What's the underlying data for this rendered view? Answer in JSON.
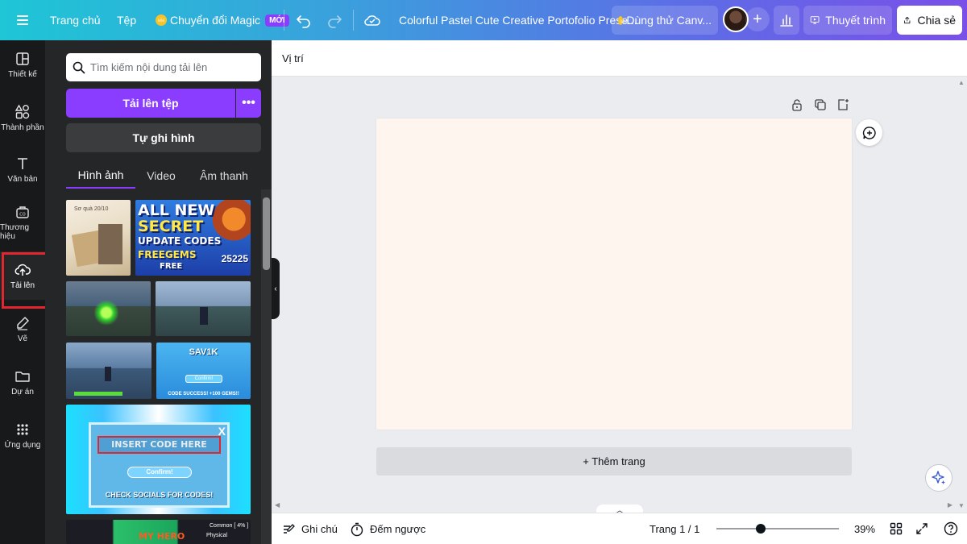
{
  "topbar": {
    "home": "Trang chủ",
    "file": "Tệp",
    "magic": "Chuyển đổi Magic",
    "magic_badge": "MỚI",
    "doc_title": "Colorful Pastel Cute Creative Portofolio Prese...",
    "trial": "Dùng thử Canv...",
    "present": "Thuyết trình",
    "share": "Chia sẻ"
  },
  "rail": {
    "items": [
      {
        "label": "Thiết kế",
        "icon": "layout-icon"
      },
      {
        "label": "Thành phần",
        "icon": "shapes-icon"
      },
      {
        "label": "Văn bản",
        "icon": "text-icon"
      },
      {
        "label": "Thương hiệu",
        "icon": "brand-icon"
      },
      {
        "label": "Tải lên",
        "icon": "cloud-upload-icon"
      },
      {
        "label": "Vẽ",
        "icon": "pen-icon"
      },
      {
        "label": "Dự án",
        "icon": "folder-icon"
      },
      {
        "label": "Ứng dụng",
        "icon": "apps-grid-icon"
      }
    ]
  },
  "panel": {
    "search_placeholder": "Tìm kiếm nội dung tải lên",
    "upload_button": "Tải lên tệp",
    "record_button": "Tự ghi hình",
    "tabs": [
      "Hình ảnh",
      "Video",
      "Âm thanh"
    ],
    "thumbnails": {
      "t1_caption": "Sơ quà 20/10",
      "t2_lines": [
        "ALL NEW",
        "SECRET",
        "UPDATE CODES",
        "FREEGEMS",
        "FREE"
      ],
      "t2_number": "25225",
      "t6_title": "SAV1K",
      "t6_button": "Confirm!",
      "t6_footer": "CODE SUCCESS! +100 GEMS!!",
      "t7_code": "INSERT CODE HERE",
      "t7_confirm": "Confirm!",
      "t7_socials": "CHECK SOCIALS FOR CODES!",
      "t7_close": "X",
      "t8_title": "MY HERO",
      "t8_rarity": "Common [ 4% ]",
      "t8_type": "Physical"
    }
  },
  "workspace": {
    "position_label": "Vị trí",
    "add_page": "+ Thêm trang",
    "page_color": "#fdf5ee"
  },
  "footer": {
    "notes": "Ghi chú",
    "timer": "Đếm ngược",
    "page_indicator": "Trang 1 / 1",
    "zoom": "39%",
    "zoom_level": 0.36
  },
  "colors": {
    "accent": "#8b3dff",
    "highlight": "#e0262e"
  }
}
